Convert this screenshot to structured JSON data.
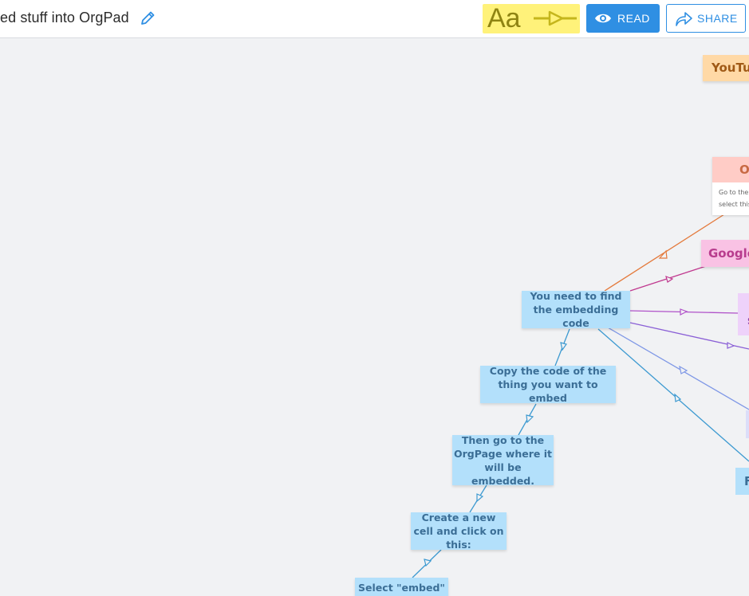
{
  "header": {
    "title": "ed stuff into OrgPad",
    "style_label": "Aa",
    "read_label": "READ",
    "share_label": "SHARE"
  },
  "colors": {
    "accent": "#2f8fe3",
    "style_button_bg": "#fff27a",
    "cell_blue": "#b3e0fb",
    "canvas_bg": "#f1f2f4"
  },
  "icons": {
    "title": "pencil-icon",
    "style": "arrow-style-icon",
    "read": "eye-icon",
    "share": "share-arrow-icon"
  },
  "cells": {
    "youtube": "YouTu",
    "orgpad_header": "O",
    "orgpad_line1": "Go to the",
    "orgpad_line2": "select this",
    "google": "Google",
    "purple": "s",
    "right": "F",
    "find_code": "You need to find the embedding code",
    "copy_code": "Copy the code of the thing you want to embed",
    "go_to_orgpage": "Then go to the OrgPage where it will be embedded.",
    "create_cell": "Create a new cell and click on this:",
    "select_embed": "Select \"embed\""
  }
}
